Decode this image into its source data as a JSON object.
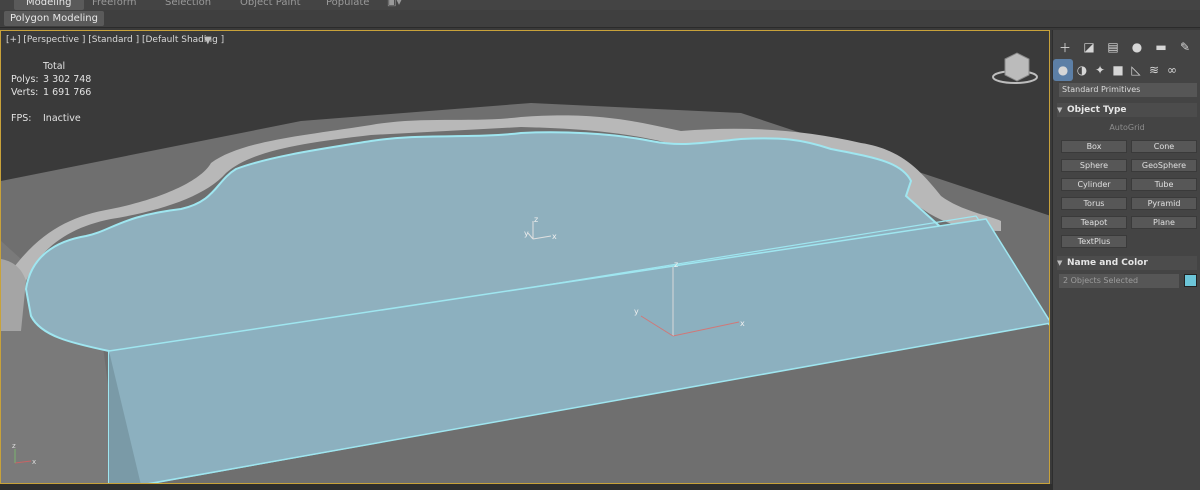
{
  "ribbon": {
    "tabs": [
      "Modeling",
      "Freeform",
      "Selection",
      "Object Paint",
      "Populate"
    ],
    "subtab": "Polygon Modeling"
  },
  "viewport": {
    "label": "[+] [Perspective ] [Standard ] [Default Shading ]",
    "stats": {
      "header": "Total",
      "polys_label": "Polys:",
      "polys_value": "3 302 748",
      "verts_label": "Verts:",
      "verts_value": "1 691 766",
      "fps_label": "FPS:",
      "fps_value": "Inactive"
    },
    "gizmo_labels": {
      "x": "x",
      "y": "y",
      "z": "z"
    }
  },
  "panel": {
    "top_icons": [
      "create-plus-icon",
      "modify-icon",
      "hierarchy-icon",
      "motion-icon",
      "display-icon",
      "utilities-wrench-icon"
    ],
    "category_icons": [
      "geometry-sphere-icon",
      "shapes-icon",
      "lights-icon",
      "cameras-icon",
      "helpers-icon",
      "space-warps-icon",
      "systems-icon"
    ],
    "dropdown": "Standard Primitives",
    "object_type_title": "Object Type",
    "autogrid": "AutoGrid",
    "buttons": [
      "Box",
      "Cone",
      "Sphere",
      "GeoSphere",
      "Cylinder",
      "Tube",
      "Torus",
      "Pyramid",
      "Teapot",
      "Plane",
      "TextPlus"
    ],
    "name_color_title": "Name and Color",
    "name_field": "2 Objects Selected",
    "selection_color": "#6cc5d8"
  },
  "colors": {
    "accent_border": "#c8a23a",
    "surface": "#8fb0be",
    "surface_edge": "#9fe6f0"
  }
}
